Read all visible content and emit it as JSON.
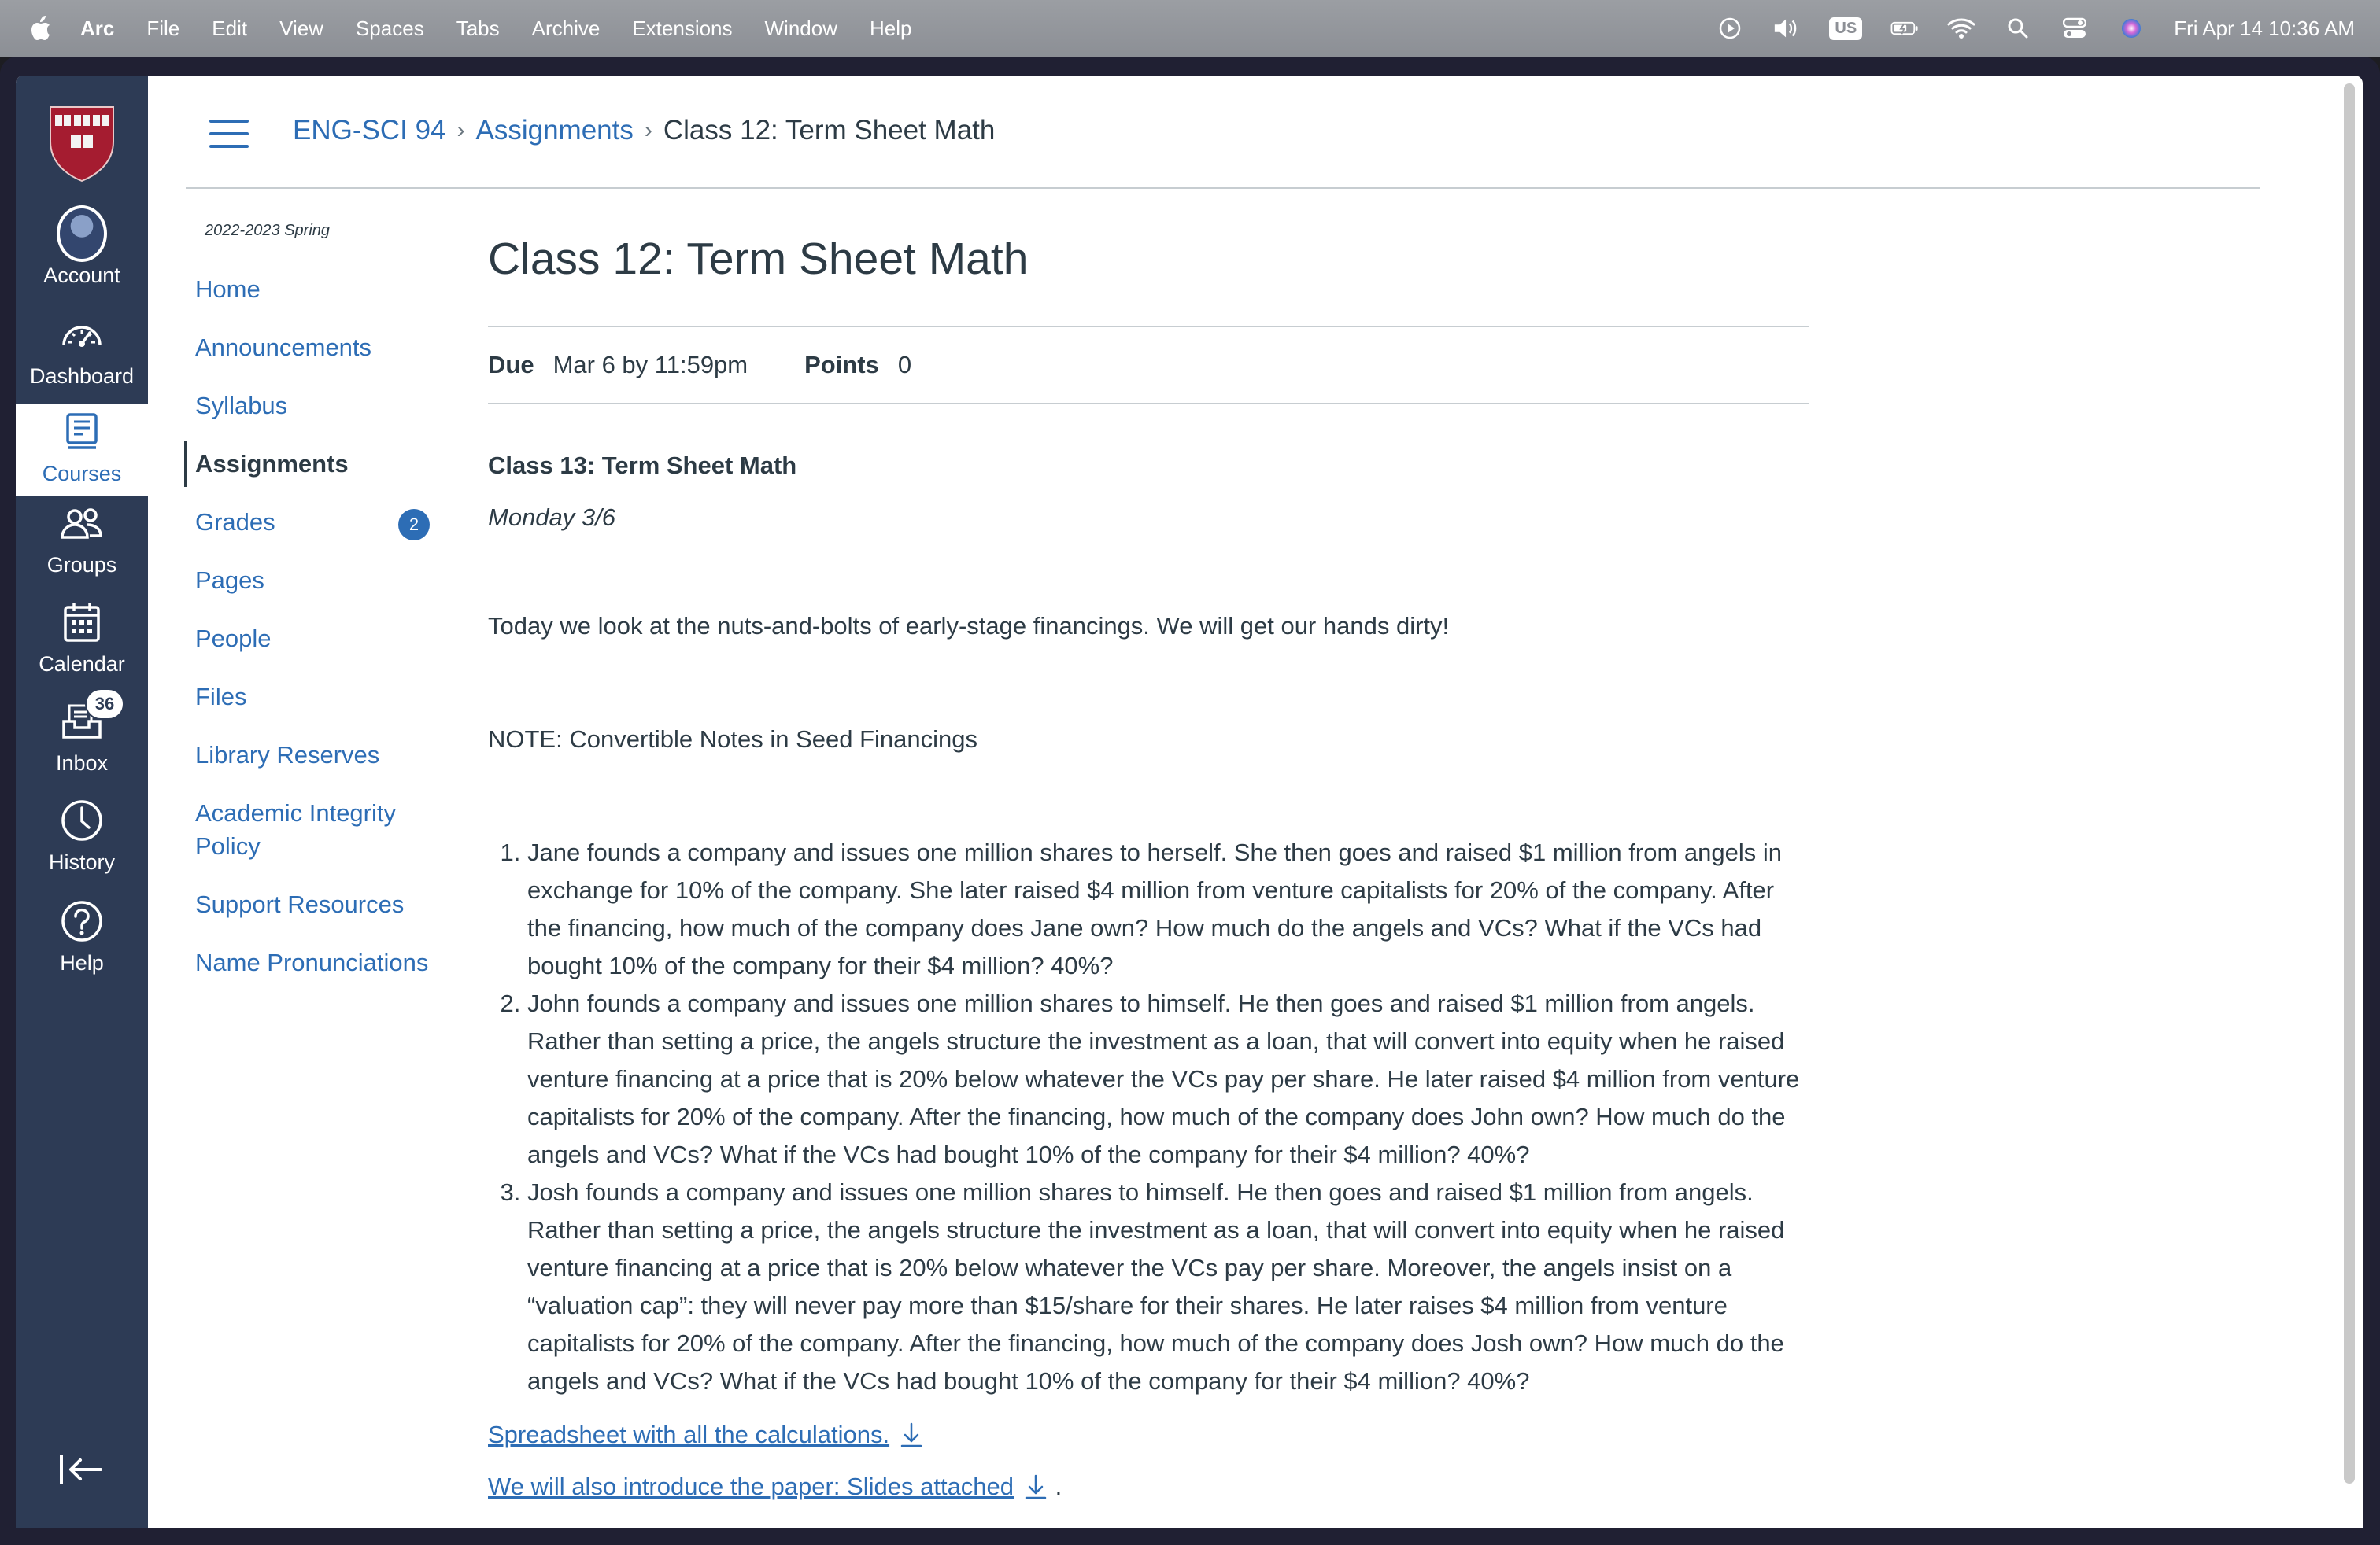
{
  "menubar": {
    "app_name": "Arc",
    "items": [
      "File",
      "Edit",
      "View",
      "Spaces",
      "Tabs",
      "Archive",
      "Extensions",
      "Window",
      "Help"
    ],
    "input_source": "US",
    "datetime": "Fri Apr 14  10:36 AM"
  },
  "global_nav": {
    "items": [
      {
        "label": "Account",
        "icon": "avatar"
      },
      {
        "label": "Dashboard",
        "icon": "dashboard-icon"
      },
      {
        "label": "Courses",
        "icon": "courses-icon",
        "active": true
      },
      {
        "label": "Groups",
        "icon": "groups-icon"
      },
      {
        "label": "Calendar",
        "icon": "calendar-icon"
      },
      {
        "label": "Inbox",
        "icon": "inbox-icon",
        "badge": "36"
      },
      {
        "label": "History",
        "icon": "history-icon"
      },
      {
        "label": "Help",
        "icon": "help-icon"
      }
    ]
  },
  "breadcrumb": {
    "course": "ENG-SCI 94",
    "section": "Assignments",
    "current": "Class 12: Term Sheet Math"
  },
  "course_nav": {
    "term": "2022-2023 Spring",
    "items": [
      {
        "label": "Home"
      },
      {
        "label": "Announcements"
      },
      {
        "label": "Syllabus"
      },
      {
        "label": "Assignments",
        "active": true
      },
      {
        "label": "Grades",
        "badge": "2"
      },
      {
        "label": "Pages"
      },
      {
        "label": "People"
      },
      {
        "label": "Files"
      },
      {
        "label": "Library Reserves"
      },
      {
        "label": "Academic Integrity Policy"
      },
      {
        "label": "Support Resources"
      },
      {
        "label": "Name Pronunciations"
      }
    ]
  },
  "assignment": {
    "title": "Class 12: Term Sheet Math",
    "due_label": "Due",
    "due_value": "Mar 6 by 11:59pm",
    "points_label": "Points",
    "points_value": "0",
    "subtitle": "Class 13: Term Sheet Math",
    "date": "Monday 3/6",
    "intro": "Today we look at the nuts-and-bolts of early-stage financings. We will get our hands dirty!",
    "note": "NOTE: Convertible Notes in Seed Financings",
    "problems": [
      "Jane founds a company and issues one million shares to herself. She then goes and raised $1 million from angels in exchange for 10% of the company. She later raised $4 million from venture capitalists for 20% of the company. After the financing, how much of the company does Jane own? How much do the angels and VCs? What if the VCs had bought 10% of the company for their $4 million? 40%?",
      "John founds a company and issues one million shares to himself. He then goes and raised $1 million from angels. Rather than setting a price, the angels structure the investment as a loan, that will convert into equity when he raised venture financing at a price that is 20% below whatever the VCs pay per share. He later raised $4 million from venture capitalists for 20% of the company. After the financing, how much of the company does John own? How much do the angels and VCs? What if the VCs had bought 10% of the company for their $4 million? 40%?",
      "Josh founds a company and issues one million shares to himself. He then goes and raised $1 million from angels. Rather than setting a price, the angels structure the investment as a loan, that will convert into equity when he raised venture financing at a price that is 20% below whatever the VCs pay per share. Moreover, the angels insist on a “valuation cap”: they will never pay more than $15/share for their shares. He later raises $4 million from venture capitalists for 20% of the company. After the financing, how much of the company does Josh own? How much do the angels and VCs? What if the VCs had bought 10% of the company for their $4 million? 40%?"
    ],
    "link1": "Spreadsheet with all the calculations.",
    "link2": "We will also introduce the paper: Slides attached",
    "link2_suffix": "."
  },
  "colors": {
    "nav_bg": "#2d3b55",
    "link": "#2d6db5",
    "text": "#2d3b45"
  }
}
